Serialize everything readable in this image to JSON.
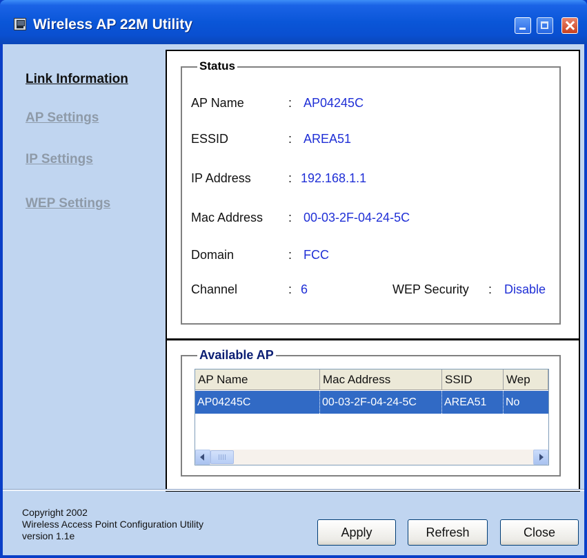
{
  "window": {
    "title": "Wireless AP 22M Utility",
    "title_bar_color": "#0a56d8",
    "client_background": "#c0d5f0"
  },
  "titlebar_buttons": {
    "minimize_icon": "minimize-icon",
    "maximize_icon": "maximize-icon",
    "close_icon": "close-icon"
  },
  "sidebar": {
    "items": [
      {
        "label": "Link Information",
        "active": true
      },
      {
        "label": "AP Settings",
        "active": false
      },
      {
        "label": "IP Settings",
        "active": false
      },
      {
        "label": "WEP Settings",
        "active": false
      }
    ]
  },
  "status": {
    "title": "Status",
    "fields": {
      "ap_name": {
        "label": "AP Name",
        "value": "AP04245C"
      },
      "essid": {
        "label": "ESSID",
        "value": "AREA51"
      },
      "ip_address": {
        "label": "IP Address",
        "value": "192.168.1.1"
      },
      "mac_address": {
        "label": "Mac Address",
        "value": "00-03-2F-04-24-5C"
      },
      "domain": {
        "label": "Domain",
        "value": "FCC"
      },
      "channel": {
        "label": "Channel",
        "value": "6"
      },
      "wep_security": {
        "label": "WEP Security",
        "value": "Disable"
      }
    },
    "separator": ":",
    "value_color": "#1f2fd6"
  },
  "available_ap": {
    "title": "Available AP",
    "columns": [
      "AP Name",
      "Mac Address",
      "SSID",
      "Wep"
    ],
    "rows": [
      [
        "AP04245C",
        "00-03-2F-04-24-5C",
        "AREA51",
        "No"
      ]
    ],
    "selected_row_color": "#316ac5"
  },
  "footer": {
    "copyright_line1": "Copyright 2002",
    "copyright_line2": "Wireless Access Point Configuration Utility",
    "copyright_line3": "version 1.1e",
    "buttons": {
      "apply": "Apply",
      "refresh": "Refresh",
      "close": "Close"
    }
  }
}
